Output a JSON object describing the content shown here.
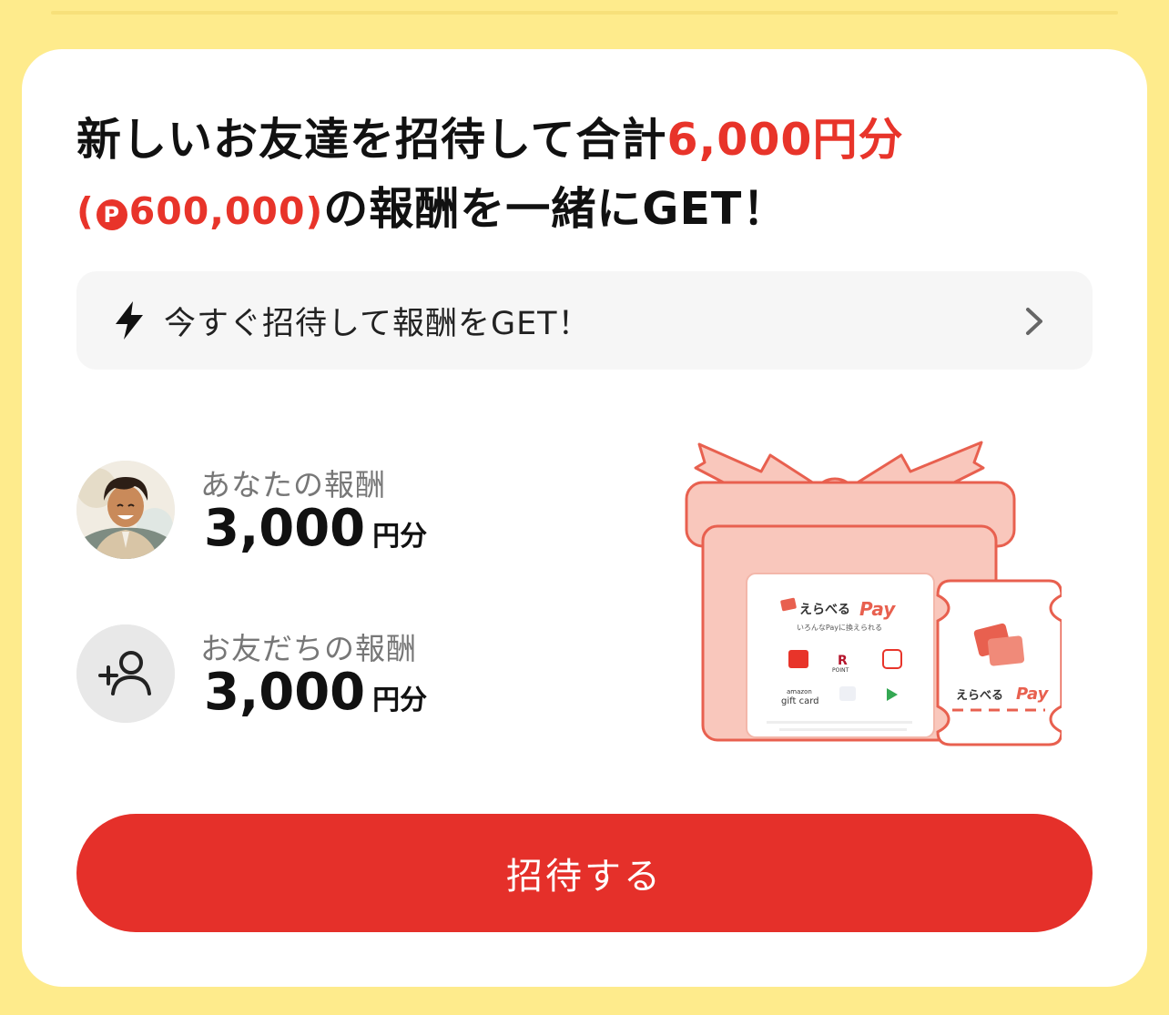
{
  "headline": {
    "part1": "新しいお友達を招待して合計",
    "amount": "6,000円分",
    "points_open": "(",
    "points_icon": "P",
    "points_value": "600,000)",
    "part2": "の報酬を一緒にGET！"
  },
  "banner": {
    "icon": "lightning-icon",
    "text": "今すぐ招待して報酬をGET！",
    "chevron": "chevron-right-icon"
  },
  "rewards": [
    {
      "label": "あなたの報酬",
      "value": "3,000",
      "unit": "円分",
      "icon": "user-avatar"
    },
    {
      "label": "お友だちの報酬",
      "value": "3,000",
      "unit": "円分",
      "icon": "add-user-icon"
    }
  ],
  "illustration": {
    "card_brand": "えらべる",
    "card_pay": "Pay",
    "card_subtitle": "いろんなPayに換えられる",
    "ticket_brand": "えらべる",
    "ticket_pay": "Pay",
    "logos": [
      "POINT",
      "amazon",
      "gift card"
    ]
  },
  "cta": {
    "label": "招待する"
  },
  "colors": {
    "accent": "#E8342A",
    "background": "#FEEB8C",
    "gift": "#F9C7BC"
  }
}
